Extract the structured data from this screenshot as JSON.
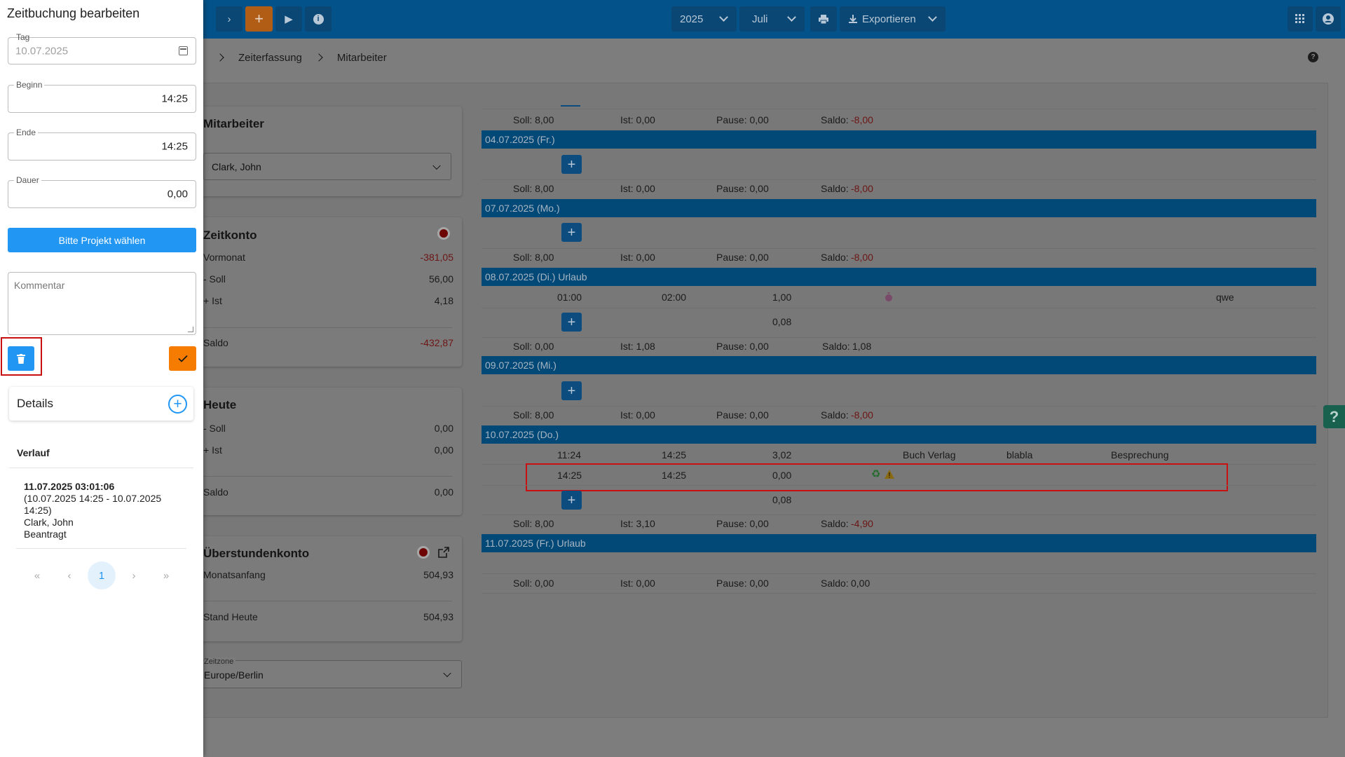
{
  "topbar": {
    "add_icon": "+",
    "play_icon": "▶",
    "info_icon": "i",
    "year": "2025",
    "month": "Juli",
    "export_label": "Exportieren"
  },
  "breadcrumb": [
    "Zeiterfassung",
    "Mitarbeiter"
  ],
  "panel": {
    "title": "Zeitbuchung bearbeiten",
    "tag_label": "Tag",
    "tag_value": "10.07.2025",
    "beginn_label": "Beginn",
    "beginn_value": "14:25",
    "ende_label": "Ende",
    "ende_value": "14:25",
    "dauer_label": "Dauer",
    "dauer_value": "0,00",
    "project_button": "Bitte Projekt wählen",
    "comment_placeholder": "Kommentar",
    "details_title": "Details",
    "verlauf_title": "Verlauf",
    "history": {
      "timestamp": "11.07.2025 03:01:06",
      "range": "(10.07.2025 14:25 - 10.07.2025 14:25)",
      "user": "Clark, John",
      "status": "Beantragt"
    },
    "pager": {
      "first": "«",
      "prev": "‹",
      "page": "1",
      "next": "›",
      "last": "»"
    }
  },
  "mitarbeiter": {
    "title": "Mitarbeiter",
    "selected": "Clark, John"
  },
  "zeitkonto": {
    "title": "Zeitkonto",
    "rows": [
      {
        "label": "Vormonat",
        "value": "-381,05"
      },
      {
        "label": "- Soll",
        "value": "56,00"
      },
      {
        "label": "+ Ist",
        "value": "4,18"
      }
    ],
    "saldo_label": "Saldo",
    "saldo_value": "-432,87"
  },
  "heute": {
    "title": "Heute",
    "rows": [
      {
        "label": "- Soll",
        "value": "0,00"
      },
      {
        "label": "+ Ist",
        "value": "0,00"
      }
    ],
    "saldo_label": "Saldo",
    "saldo_value": "0,00"
  },
  "ueberstunden": {
    "title": "Überstundenkonto",
    "monatsanfang_label": "Monatsanfang",
    "monatsanfang_value": "504,93",
    "stand_label": "Stand Heute",
    "stand_value": "504,93"
  },
  "zeitzone": {
    "label": "Zeitzone",
    "value": "Europe/Berlin"
  },
  "timesheet": {
    "summaries": [
      {
        "soll": "Soll: 8,00",
        "ist": "Ist: 0,00",
        "pause": "Pause: 0,00",
        "saldo_label": "Saldo:",
        "saldo": "-8,00"
      },
      {
        "soll": "Soll: 8,00",
        "ist": "Ist: 0,00",
        "pause": "Pause: 0,00",
        "saldo_label": "Saldo:",
        "saldo": "-8,00"
      },
      {
        "soll": "Soll: 8,00",
        "ist": "Ist: 0,00",
        "pause": "Pause: 0,00",
        "saldo_label": "Saldo:",
        "saldo": "-8,00"
      },
      {
        "soll": "Soll: 0,00",
        "ist": "Ist: 1,08",
        "pause": "Pause: 0,00",
        "saldo_label": "Saldo:",
        "saldo": "1,08"
      },
      {
        "soll": "Soll: 8,00",
        "ist": "Ist: 0,00",
        "pause": "Pause: 0,00",
        "saldo_label": "Saldo:",
        "saldo": "-8,00"
      },
      {
        "soll": "Soll: 8,00",
        "ist": "Ist: 3,10",
        "pause": "Pause: 0,00",
        "saldo_label": "Saldo:",
        "saldo": "-4,90"
      },
      {
        "soll": "Soll: 0,00",
        "ist": "Ist: 0,00",
        "pause": "Pause: 0,00",
        "saldo_label": "Saldo:",
        "saldo": "0,00"
      }
    ],
    "days": [
      "04.07.2025 (Fr.)",
      "07.07.2025 (Mo.)",
      "08.07.2025 (Di.) Urlaub",
      "09.07.2025 (Mi.)",
      "10.07.2025 (Do.)",
      "11.07.2025 (Fr.) Urlaub"
    ],
    "entry_0807": {
      "start": "01:00",
      "end": "02:00",
      "dauer": "1,00",
      "note": "qwe",
      "subtotal": "0,08"
    },
    "entry_1007_a": {
      "start": "11:24",
      "end": "14:25",
      "dauer": "3,02",
      "customer": "Buch Verlag",
      "project": "blabla",
      "task": "Besprechung"
    },
    "entry_1007_b": {
      "start": "14:25",
      "end": "14:25",
      "dauer": "0,00"
    },
    "subtotal_1007": "0,08",
    "plus": "+"
  },
  "colors": {
    "primary": "#2196f3",
    "accent": "#f57c00",
    "highlight": "#c81010"
  }
}
